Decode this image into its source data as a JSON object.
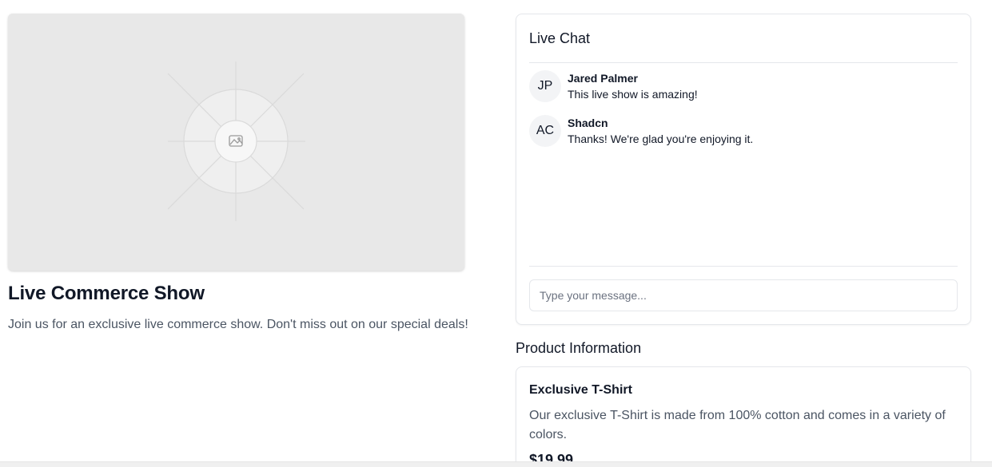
{
  "show": {
    "title": "Live Commerce Show",
    "description": "Join us for an exclusive live commerce show. Don't miss out on our special deals!"
  },
  "chat": {
    "title": "Live Chat",
    "messages": [
      {
        "initials": "JP",
        "name": "Jared Palmer",
        "text": "This live show is amazing!"
      },
      {
        "initials": "AC",
        "name": "Shadcn",
        "text": "Thanks! We're glad you're enjoying it."
      }
    ],
    "input_placeholder": "Type your message..."
  },
  "product": {
    "heading": "Product Information",
    "name": "Exclusive T-Shirt",
    "description": "Our exclusive T-Shirt is made from 100% cotton and comes in a variety of colors.",
    "price": "$19.99"
  },
  "colors": {
    "placeholder_bg": "#e8e8e8",
    "border": "#e5e7eb",
    "muted_text": "#4b5563"
  },
  "icons": {
    "video_placeholder": "image-icon"
  }
}
